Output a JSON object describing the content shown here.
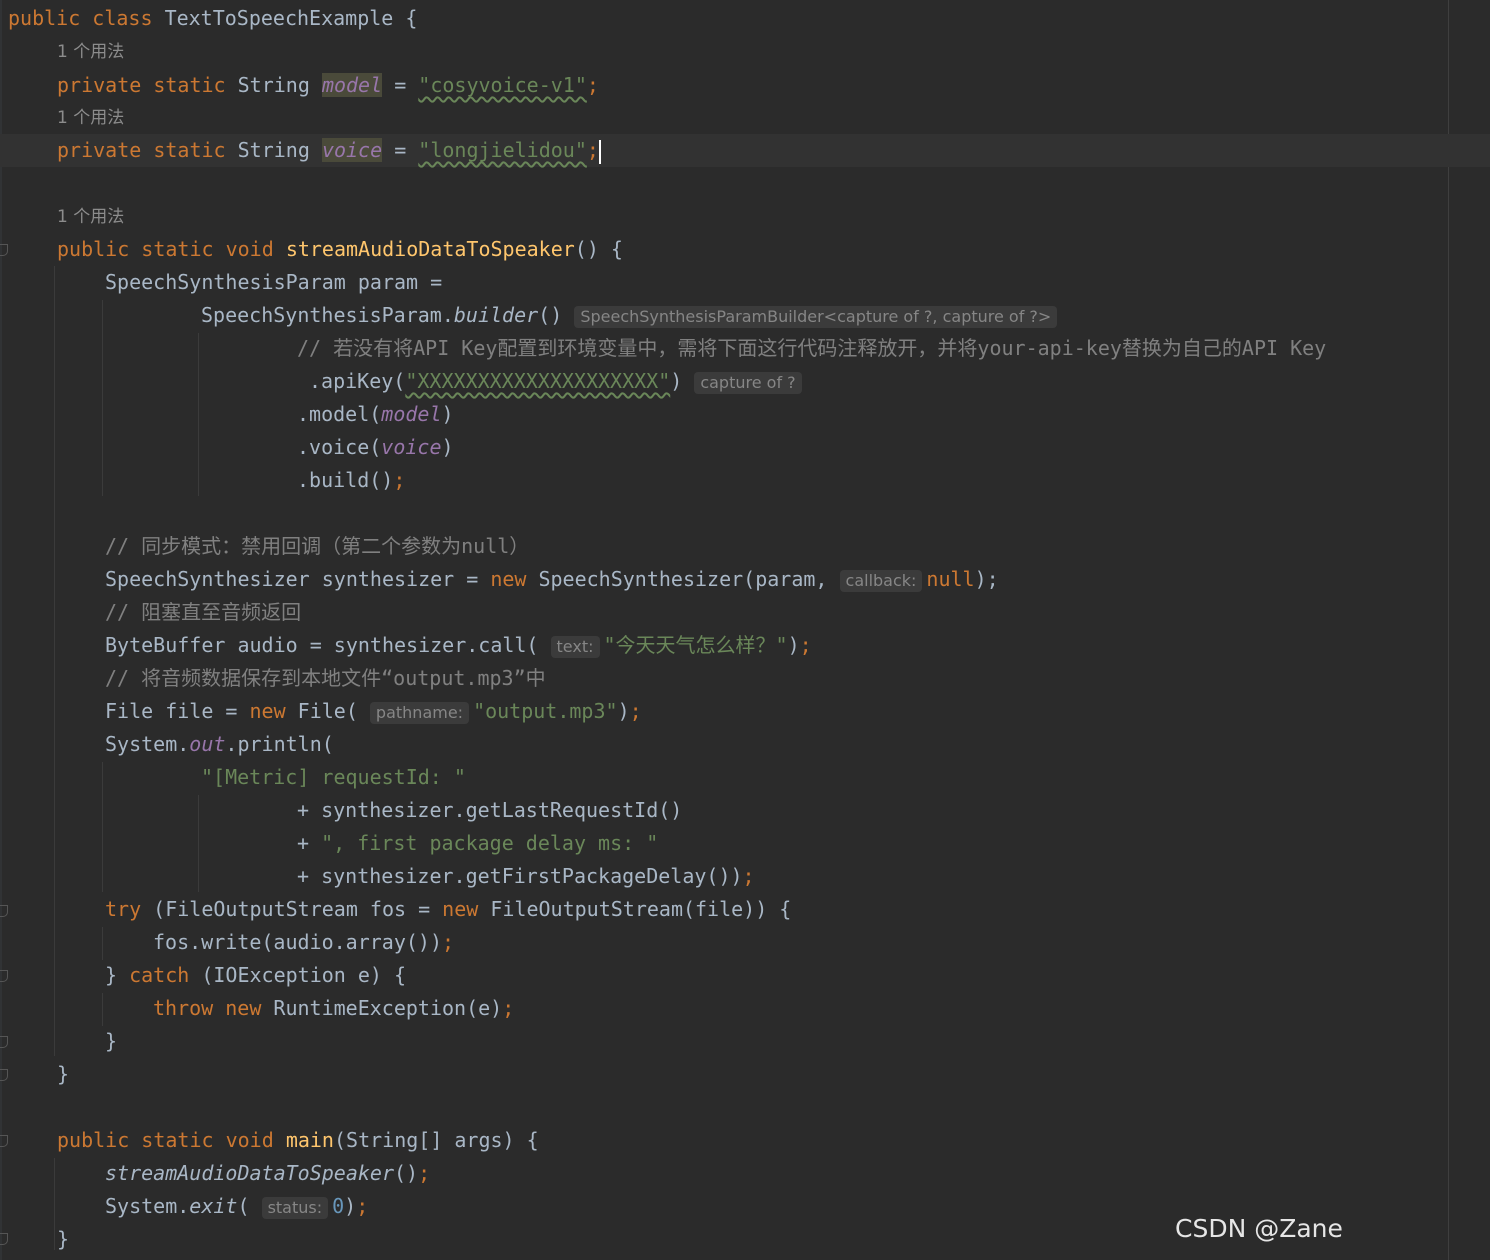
{
  "editor": {
    "inlay_usage": "1 个用法",
    "class_decl": {
      "kw_public": "public",
      "kw_class": "class",
      "name": "TextToSpeechExample",
      "brace": " {"
    },
    "field_model": {
      "kw_private": "private",
      "kw_static": "static",
      "type": "String",
      "name": "model",
      "eq": " = ",
      "value": "\"cosyvoice-v1\"",
      "semi": ";"
    },
    "field_voice": {
      "kw_private": "private",
      "kw_static": "static",
      "type": "String",
      "name": "voice",
      "eq": " = ",
      "value": "\"longjielidou\"",
      "semi": ";"
    },
    "method_stream": {
      "kw_public": "public",
      "kw_static": "static",
      "kw_void": "void",
      "name": "streamAudioDataToSpeaker",
      "sig": "() {"
    },
    "line_param_decl": "SpeechSynthesisParam param =",
    "line_builder_prefix": "SpeechSynthesisParam.",
    "line_builder_method": "builder",
    "line_builder_suffix": "()",
    "hint_builder_type": "SpeechSynthesisParamBuilder<capture of ?, capture of ?>",
    "comment_apikey": "// 若没有将API Key配置到环境变量中，需将下面这行代码注释放开，并将your-api-key替换为自己的API Key",
    "apikey_prefix": ".apiKey(",
    "apikey_value": "\"XXXXXXXXXXXXXXXXXXXX\"",
    "apikey_suffix": ")",
    "hint_capture": "capture of ?",
    "model_call_prefix": ".model(",
    "model_call_arg": "model",
    "model_call_suffix": ")",
    "voice_call_prefix": ".voice(",
    "voice_call_arg": "voice",
    "voice_call_suffix": ")",
    "build_call": ".build()",
    "semi": ";",
    "comment_sync": "// 同步模式：禁用回调（第二个参数为null）",
    "synth_decl_prefix": "SpeechSynthesizer synthesizer = ",
    "kw_new": "new",
    "synth_decl_mid": " SpeechSynthesizer(param, ",
    "hint_callback": "callback:",
    "kw_null": "null",
    "synth_decl_suffix": ");",
    "comment_block": "// 阻塞直至音频返回",
    "audio_decl_prefix": "ByteBuffer audio = synthesizer.call(",
    "hint_text": "text:",
    "audio_call_arg": "\"今天天气怎么样？\"",
    "audio_call_suffix": ")",
    "comment_save": "// 将音频数据保存到本地文件“output.mp3”中",
    "file_decl_prefix": "File file = ",
    "file_decl_mid": " File(",
    "hint_pathname": "pathname:",
    "file_arg": "\"output.mp3\"",
    "close_paren": ")",
    "println_prefix": "System.",
    "println_out": "out",
    "println_suffix": ".println(",
    "metric_str": "\"[Metric] requestId: \"",
    "plus_prefix": "+ ",
    "get_last_request": "synthesizer.getLastRequestId()",
    "first_pkg_str": "\", first package delay ms: \"",
    "get_first_pkg": "synthesizer.getFirstPackageDelay())",
    "kw_try": "try",
    "try_rest": " (FileOutputStream fos = ",
    "try_ctor": " FileOutputStream(file)) {",
    "fos_write": "fos.write(audio.array())",
    "catch_prefix": "} ",
    "kw_catch": "catch",
    "catch_rest": " (IOException e) {",
    "kw_throw": "throw",
    "throw_rest": " RuntimeException(e)",
    "close_brace": "}",
    "method_main": {
      "kw_public": "public",
      "kw_static": "static",
      "kw_void": "void",
      "name": "main",
      "sig": "(String[] args) {"
    },
    "call_stream": "streamAudioDataToSpeaker",
    "call_stream_suffix": "()",
    "exit_prefix": "System.",
    "exit_method": "exit",
    "exit_open": "(",
    "hint_status": "status:",
    "exit_arg": "0",
    "exit_close": ")"
  },
  "watermark": "CSDN @Zane",
  "colors": {
    "background": "#2b2b2b",
    "keyword": "#cc7832",
    "string": "#6a8759",
    "method_decl": "#ffc66d",
    "field": "#9876aa",
    "default_text": "#a9b7c6",
    "comment": "#808080",
    "number": "#6897bb"
  }
}
